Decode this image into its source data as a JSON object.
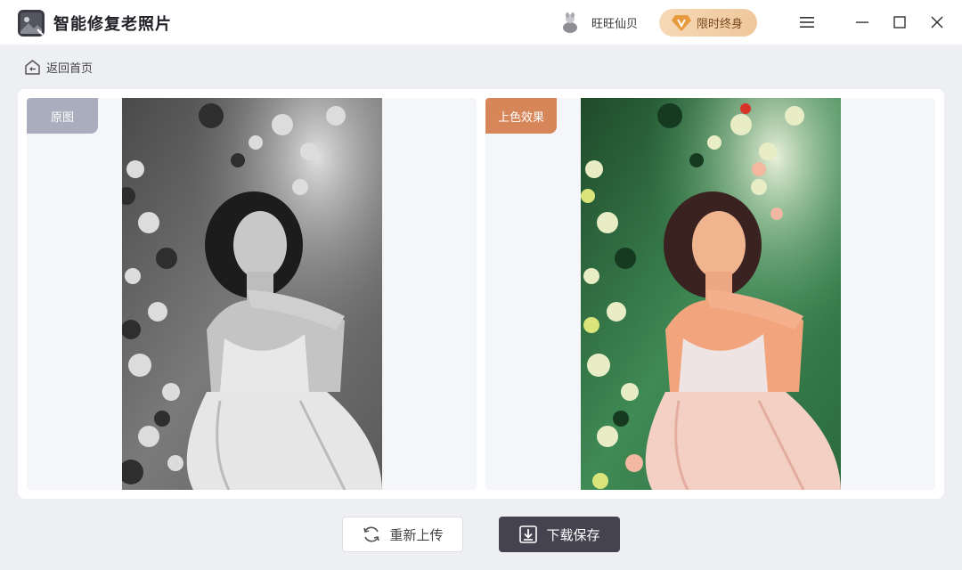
{
  "app": {
    "title": "智能修复老照片",
    "user_name": "旺旺仙贝",
    "vip_label": "限时终身"
  },
  "nav": {
    "back_label": "返回首页"
  },
  "compare": {
    "original_label": "原图",
    "result_label": "上色效果"
  },
  "actions": {
    "reupload_label": "重新上传",
    "download_label": "下载保存"
  },
  "colors": {
    "accent_dark": "#45434f",
    "vip_gold": "#efc79c",
    "tag_gray": "#a9adbd",
    "tag_orange": "#d7865a"
  },
  "icons": {
    "logo": "photo-restore-icon",
    "vip": "diamond-v-icon",
    "menu": "hamburger-icon",
    "minimize": "minimize-icon",
    "maximize": "maximize-icon",
    "close": "close-icon",
    "back": "home-icon",
    "reupload": "refresh-icon",
    "download": "download-icon"
  }
}
